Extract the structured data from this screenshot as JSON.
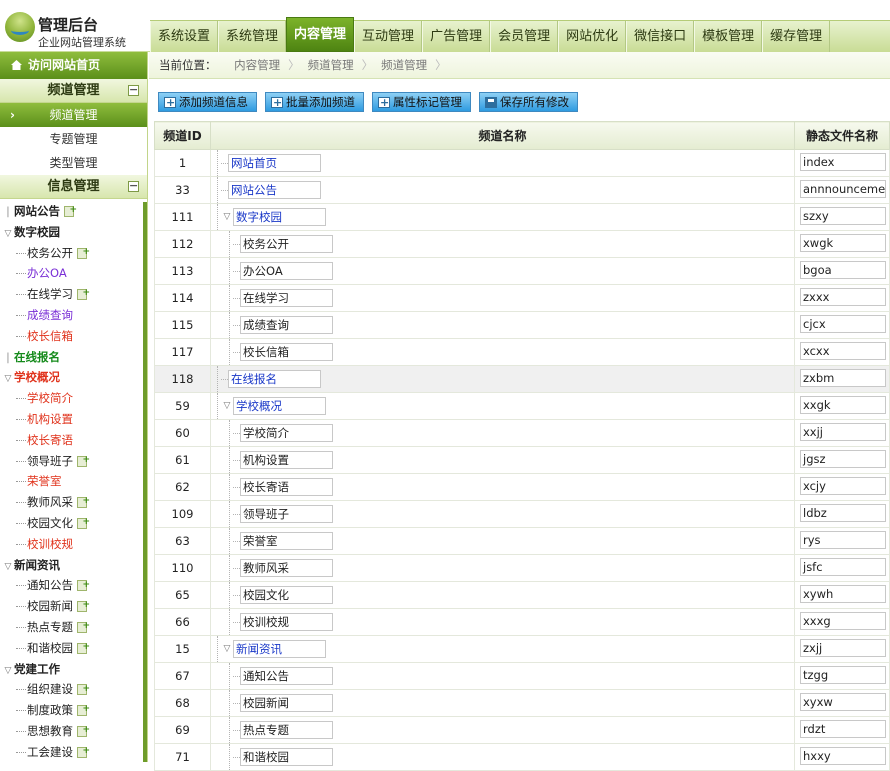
{
  "header": {
    "title": "管理后台",
    "subtitle": "企业网站管理系统",
    "tabs": [
      "系统设置",
      "系统管理",
      "内容管理",
      "互动管理",
      "广告管理",
      "会员管理",
      "网站优化",
      "微信接口",
      "模板管理",
      "缓存管理"
    ],
    "active_tab": "内容管理"
  },
  "sidebar": {
    "home_label": "访问网站首页",
    "group1": {
      "title": "频道管理",
      "items": [
        "频道管理",
        "专题管理",
        "类型管理"
      ]
    },
    "group2": {
      "title": "信息管理"
    },
    "tree": [
      {
        "label": "网站公告",
        "level": 0,
        "color": "c-black",
        "expand": false,
        "add": true
      },
      {
        "label": "数字校园",
        "level": 0,
        "color": "c-black",
        "expand": true,
        "add": false
      },
      {
        "label": "校务公开",
        "level": 1,
        "color": "c-black",
        "add": true
      },
      {
        "label": "办公OA",
        "level": 1,
        "color": "c-purple",
        "add": false
      },
      {
        "label": "在线学习",
        "level": 1,
        "color": "c-black",
        "add": true
      },
      {
        "label": "成绩查询",
        "level": 1,
        "color": "c-purple",
        "add": false
      },
      {
        "label": "校长信箱",
        "level": 1,
        "color": "c-red",
        "add": false
      },
      {
        "label": "在线报名",
        "level": 0,
        "color": "c-green",
        "expand": false,
        "add": false
      },
      {
        "label": "学校概况",
        "level": 0,
        "color": "c-red",
        "expand": true,
        "add": false
      },
      {
        "label": "学校简介",
        "level": 1,
        "color": "c-red",
        "add": false
      },
      {
        "label": "机构设置",
        "level": 1,
        "color": "c-red",
        "add": false
      },
      {
        "label": "校长寄语",
        "level": 1,
        "color": "c-red",
        "add": false
      },
      {
        "label": "领导班子",
        "level": 1,
        "color": "c-black",
        "add": true
      },
      {
        "label": "荣誉室",
        "level": 1,
        "color": "c-red",
        "add": false
      },
      {
        "label": "教师风采",
        "level": 1,
        "color": "c-black",
        "add": true
      },
      {
        "label": "校园文化",
        "level": 1,
        "color": "c-black",
        "add": true
      },
      {
        "label": "校训校规",
        "level": 1,
        "color": "c-red",
        "add": false
      },
      {
        "label": "新闻资讯",
        "level": 0,
        "color": "c-black",
        "expand": true,
        "add": false
      },
      {
        "label": "通知公告",
        "level": 1,
        "color": "c-black",
        "add": true
      },
      {
        "label": "校园新闻",
        "level": 1,
        "color": "c-black",
        "add": true
      },
      {
        "label": "热点专题",
        "level": 1,
        "color": "c-black",
        "add": true
      },
      {
        "label": "和谐校园",
        "level": 1,
        "color": "c-black",
        "add": true
      },
      {
        "label": "党建工作",
        "level": 0,
        "color": "c-black",
        "expand": true,
        "add": false
      },
      {
        "label": "组织建设",
        "level": 1,
        "color": "c-black",
        "add": true
      },
      {
        "label": "制度政策",
        "level": 1,
        "color": "c-black",
        "add": true
      },
      {
        "label": "思想教育",
        "level": 1,
        "color": "c-black",
        "add": true
      },
      {
        "label": "工会建设",
        "level": 1,
        "color": "c-black",
        "add": true
      }
    ]
  },
  "breadcrumb": {
    "label": "当前位置：",
    "parts": [
      "内容管理",
      "频道管理",
      "频道管理"
    ]
  },
  "toolbar": [
    "添加频道信息",
    "批量添加频道",
    "属性标记管理",
    "保存所有修改"
  ],
  "table": {
    "headers": [
      "频道ID",
      "频道名称",
      "静态文件名称"
    ],
    "rows": [
      {
        "id": "1",
        "name": "网站首页",
        "file": "index",
        "depth": 0,
        "expand": false,
        "color": "blue"
      },
      {
        "id": "33",
        "name": "网站公告",
        "file": "annnouncement",
        "depth": 0,
        "expand": false,
        "color": "blue"
      },
      {
        "id": "111",
        "name": "数字校园",
        "file": "szxy",
        "depth": 0,
        "expand": true,
        "color": "blue"
      },
      {
        "id": "112",
        "name": "校务公开",
        "file": "xwgk",
        "depth": 1,
        "expand": false,
        "color": "dark"
      },
      {
        "id": "113",
        "name": "办公OA",
        "file": "bgoa",
        "depth": 1,
        "expand": false,
        "color": "dark"
      },
      {
        "id": "114",
        "name": "在线学习",
        "file": "zxxx",
        "depth": 1,
        "expand": false,
        "color": "dark"
      },
      {
        "id": "115",
        "name": "成绩查询",
        "file": "cjcx",
        "depth": 1,
        "expand": false,
        "color": "dark"
      },
      {
        "id": "117",
        "name": "校长信箱",
        "file": "xcxx",
        "depth": 1,
        "expand": false,
        "color": "dark"
      },
      {
        "id": "118",
        "name": "在线报名",
        "file": "zxbm",
        "depth": 0,
        "expand": false,
        "color": "blue",
        "highlight": true
      },
      {
        "id": "59",
        "name": "学校概况",
        "file": "xxgk",
        "depth": 0,
        "expand": true,
        "color": "blue"
      },
      {
        "id": "60",
        "name": "学校简介",
        "file": "xxjj",
        "depth": 1,
        "expand": false,
        "color": "dark"
      },
      {
        "id": "61",
        "name": "机构设置",
        "file": "jgsz",
        "depth": 1,
        "expand": false,
        "color": "dark"
      },
      {
        "id": "62",
        "name": "校长寄语",
        "file": "xcjy",
        "depth": 1,
        "expand": false,
        "color": "dark"
      },
      {
        "id": "109",
        "name": "领导班子",
        "file": "ldbz",
        "depth": 1,
        "expand": false,
        "color": "dark"
      },
      {
        "id": "63",
        "name": "荣誉室",
        "file": "rys",
        "depth": 1,
        "expand": false,
        "color": "dark"
      },
      {
        "id": "110",
        "name": "教师风采",
        "file": "jsfc",
        "depth": 1,
        "expand": false,
        "color": "dark"
      },
      {
        "id": "65",
        "name": "校园文化",
        "file": "xywh",
        "depth": 1,
        "expand": false,
        "color": "dark"
      },
      {
        "id": "66",
        "name": "校训校规",
        "file": "xxxg",
        "depth": 1,
        "expand": false,
        "color": "dark"
      },
      {
        "id": "15",
        "name": "新闻资讯",
        "file": "zxjj",
        "depth": 0,
        "expand": true,
        "color": "blue"
      },
      {
        "id": "67",
        "name": "通知公告",
        "file": "tzgg",
        "depth": 1,
        "expand": false,
        "color": "dark"
      },
      {
        "id": "68",
        "name": "校园新闻",
        "file": "xyxw",
        "depth": 1,
        "expand": false,
        "color": "dark"
      },
      {
        "id": "69",
        "name": "热点专题",
        "file": "rdzt",
        "depth": 1,
        "expand": false,
        "color": "dark"
      },
      {
        "id": "71",
        "name": "和谐校园",
        "file": "hxxy",
        "depth": 1,
        "expand": false,
        "color": "dark"
      }
    ]
  }
}
